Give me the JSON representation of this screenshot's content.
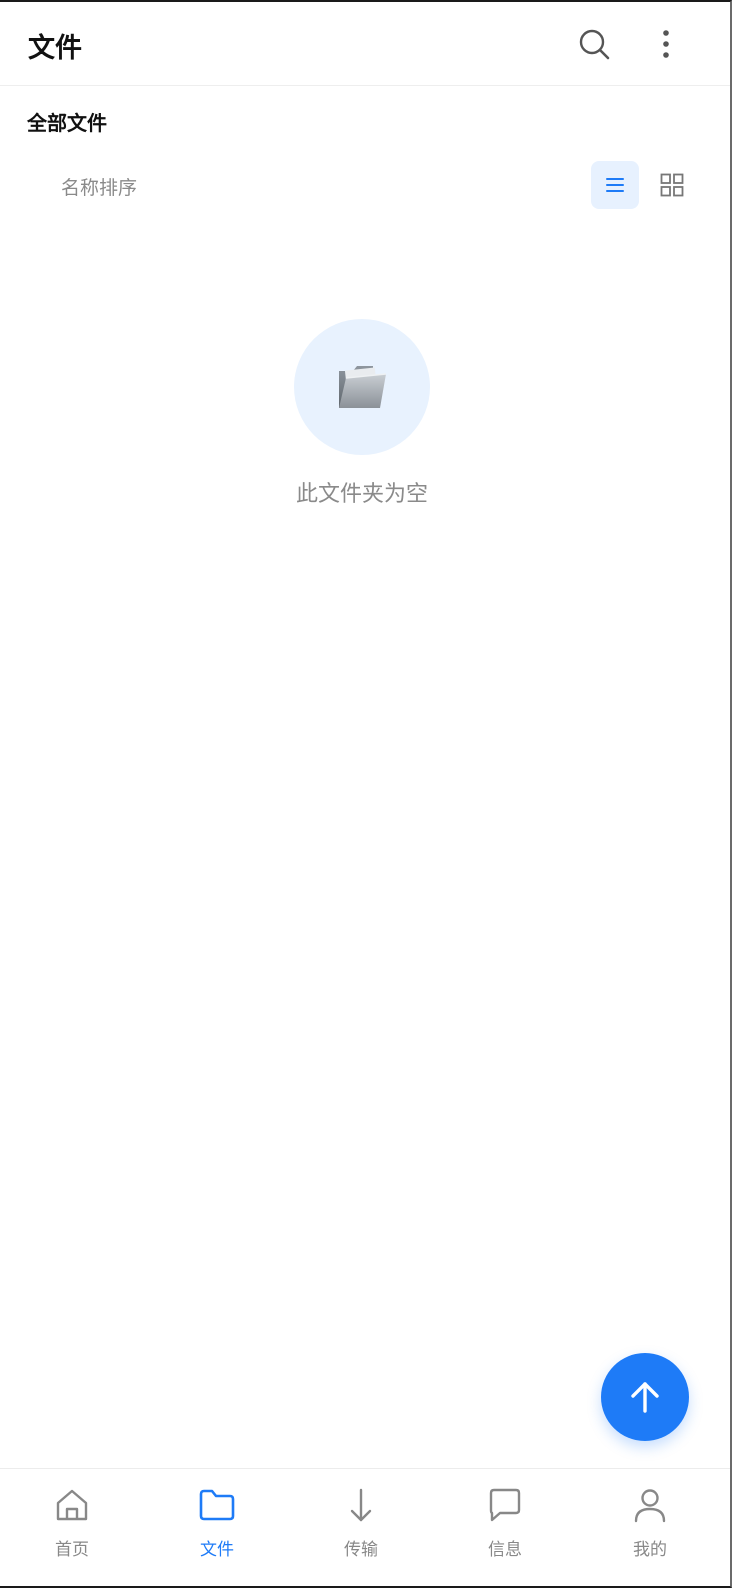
{
  "header": {
    "title": "文件",
    "search_icon": "search-icon",
    "more_icon": "more-vertical-icon"
  },
  "breadcrumb": {
    "label": "全部文件"
  },
  "sort": {
    "label": "名称排序",
    "view_mode": "list"
  },
  "empty_state": {
    "icon": "open-folder-icon",
    "message": "此文件夹为空"
  },
  "fab": {
    "icon": "arrow-up-icon"
  },
  "bottom_nav": {
    "items": [
      {
        "label": "首页",
        "icon": "home-icon",
        "active": false
      },
      {
        "label": "文件",
        "icon": "folder-icon",
        "active": true
      },
      {
        "label": "传输",
        "icon": "arrow-down-icon",
        "active": false
      },
      {
        "label": "信息",
        "icon": "message-icon",
        "active": false
      },
      {
        "label": "我的",
        "icon": "user-icon",
        "active": false
      }
    ]
  },
  "colors": {
    "accent": "#1e7bf7",
    "accent_light": "#e7f1fe",
    "muted_text": "#8a8a8a",
    "title_text": "#111111"
  }
}
